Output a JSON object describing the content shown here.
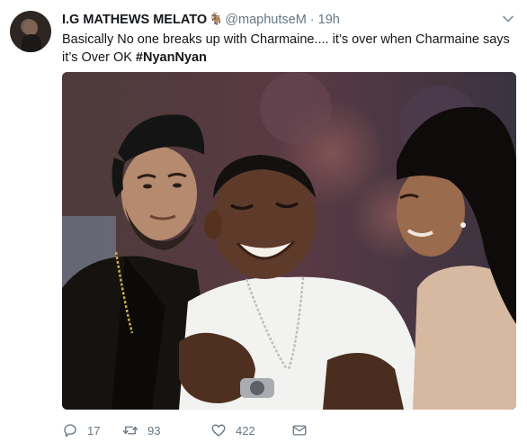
{
  "tweet": {
    "display_name": "I.G MATHEWS MELATO",
    "name_emoji": "goat-emoji",
    "handle": "@maphutseM",
    "separator": "·",
    "timestamp": "19h",
    "text_main": "Basically No one breaks up with Charmaine.... it’s over when Charmaine says it’s Over OK ",
    "hashtag": "#NyanNyan"
  },
  "actions": {
    "reply_icon": "reply-icon",
    "reply_count": "17",
    "retweet_icon": "retweet-icon",
    "retweet_count": "93",
    "like_icon": "heart-icon",
    "like_count": "422",
    "dm_icon": "envelope-icon"
  },
  "colors": {
    "text": "#14171a",
    "secondary": "#657786",
    "background": "#ffffff"
  }
}
